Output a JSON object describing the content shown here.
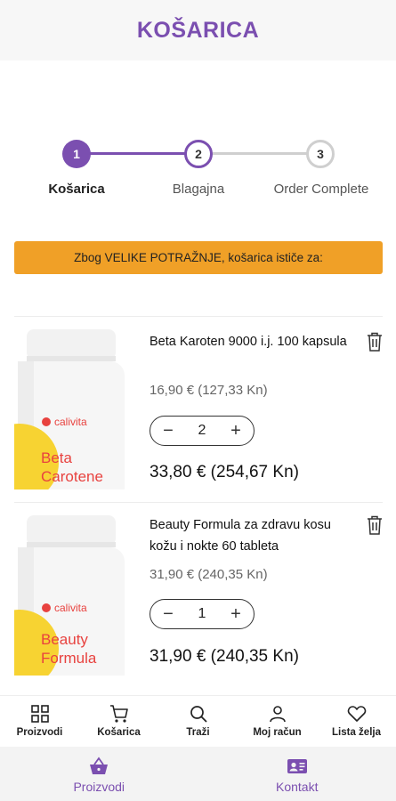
{
  "header": {
    "title": "KOŠARICA"
  },
  "steps": [
    {
      "number": "1",
      "label": "Košarica"
    },
    {
      "number": "2",
      "label": "Blagajna"
    },
    {
      "number": "3",
      "label": "Order Complete"
    }
  ],
  "banner": {
    "text": "Zbog VELIKE POTRAŽNJE, košarica ističe za:"
  },
  "items": [
    {
      "name": "Beta Karoten 9000 i.j. 100 kapsula",
      "unit_price": "16,90 € (127,33 Kn)",
      "quantity": "2",
      "total": "33,80 € (254,67 Kn)",
      "brand": "calivita",
      "product_label_line1": "Beta",
      "product_label_line2": "Carotene"
    },
    {
      "name": "Beauty Formula za zdravu kosu kožu i nokte 60 tableta",
      "unit_price": "31,90 € (240,35 Kn)",
      "quantity": "1",
      "total": "31,90 € (240,35 Kn)",
      "brand": "calivita",
      "product_label_line1": "Beauty",
      "product_label_line2": "Formula"
    }
  ],
  "stepper_symbols": {
    "minus": "−",
    "plus": "+"
  },
  "tabbar": [
    {
      "label": "Proizvodi",
      "icon": "grid-icon"
    },
    {
      "label": "Košarica",
      "icon": "cart-icon"
    },
    {
      "label": "Traži",
      "icon": "search-icon"
    },
    {
      "label": "Moj račun",
      "icon": "user-icon"
    },
    {
      "label": "Lista želja",
      "icon": "heart-icon"
    }
  ],
  "bottom_nav": [
    {
      "label": "Proizvodi",
      "icon": "basket-icon"
    },
    {
      "label": "Kontakt",
      "icon": "contact-card-icon"
    }
  ],
  "colors": {
    "accent": "#7b4fb0",
    "banner": "#f0a027"
  }
}
